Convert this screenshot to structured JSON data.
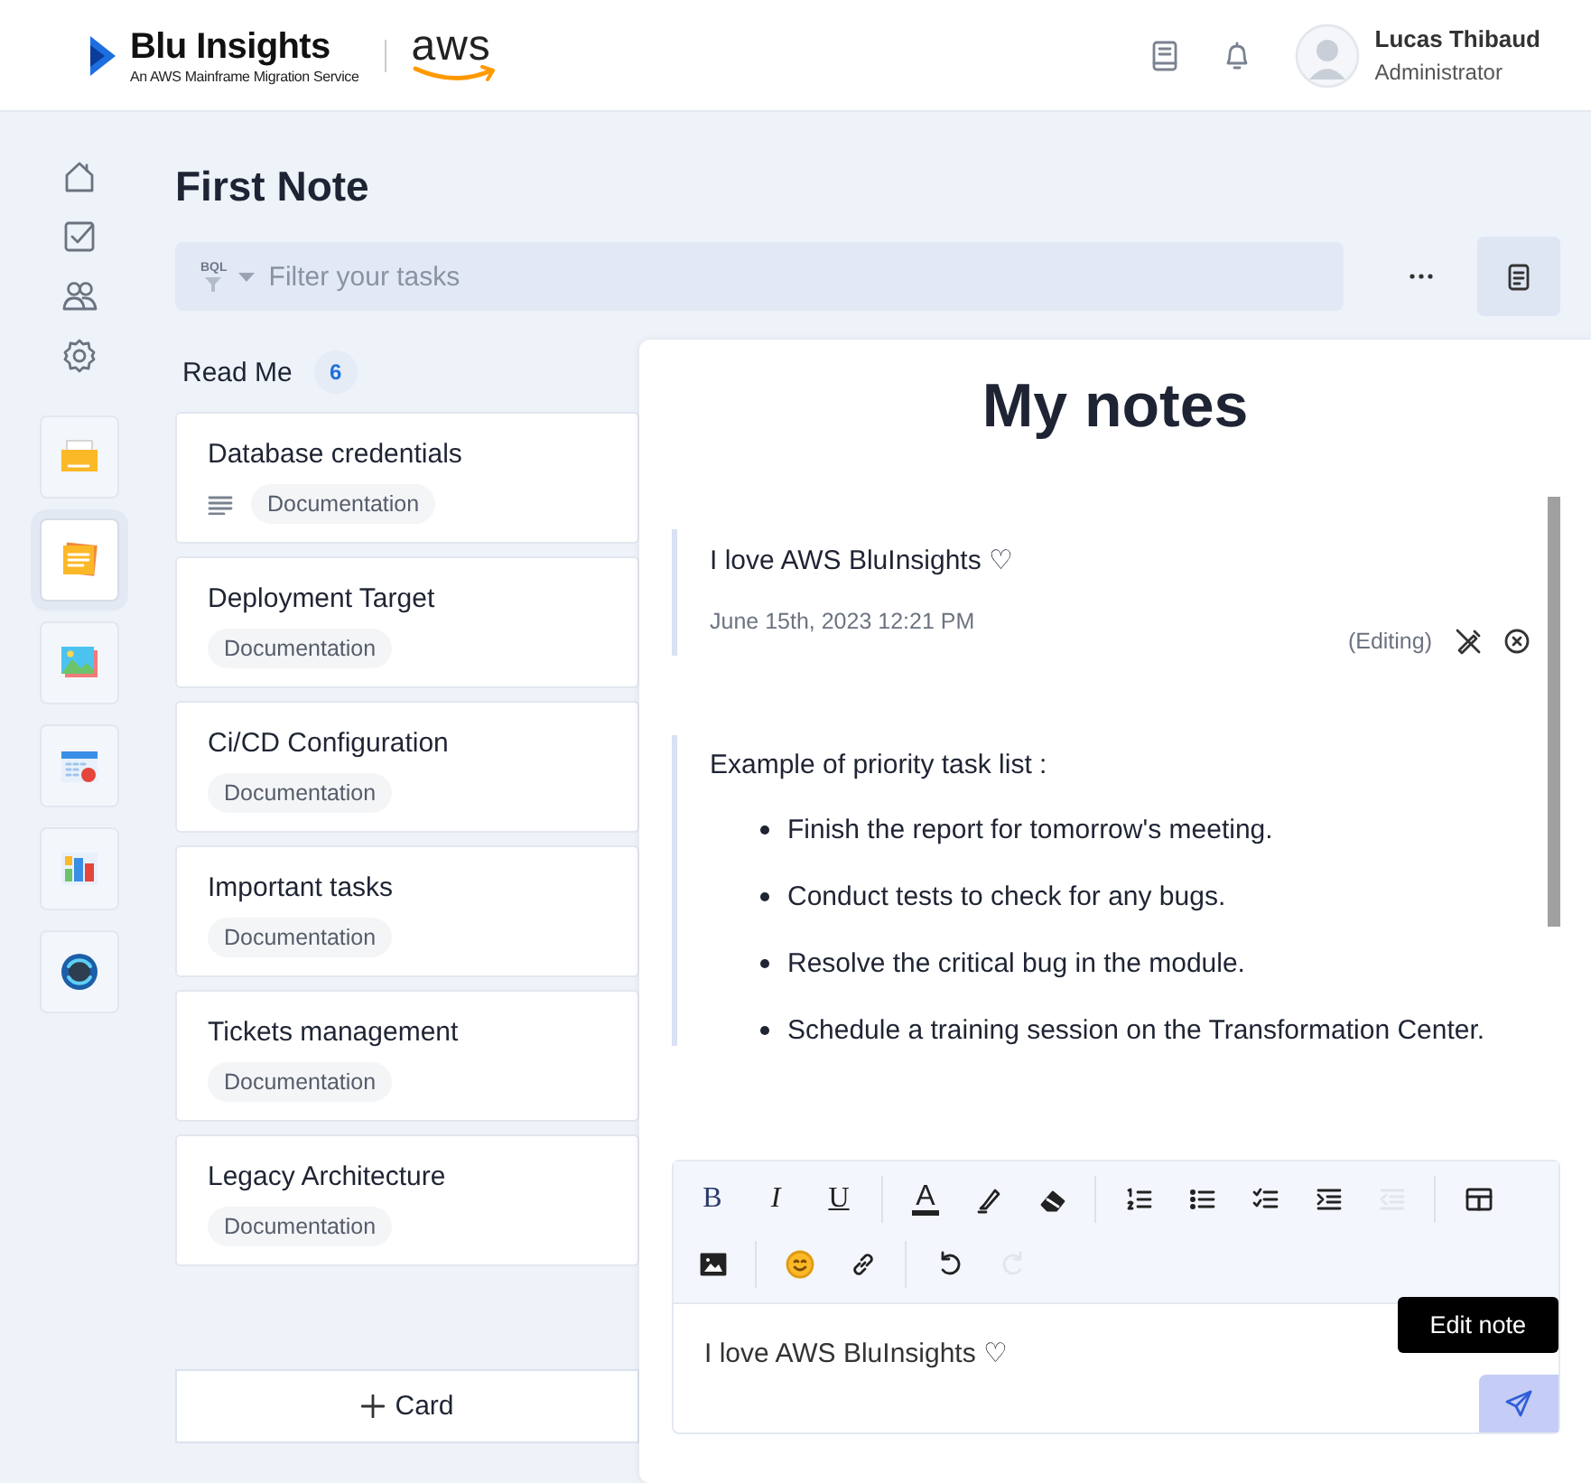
{
  "header": {
    "logo_title": "Blu Insights",
    "logo_subtitle": "An AWS Mainframe Migration Service",
    "partner_logo": "aws",
    "user": {
      "name": "Lucas Thibaud",
      "role": "Administrator"
    }
  },
  "nav": {
    "links": [
      {
        "kind": "home"
      },
      {
        "kind": "tasks"
      },
      {
        "kind": "users"
      },
      {
        "kind": "settings"
      }
    ],
    "apps": [
      {
        "kind": "folder",
        "selected": false
      },
      {
        "kind": "notes",
        "selected": true
      },
      {
        "kind": "gallery",
        "selected": false
      },
      {
        "kind": "calendar",
        "selected": false
      },
      {
        "kind": "dashboard",
        "selected": false
      },
      {
        "kind": "sync",
        "selected": false
      }
    ]
  },
  "page": {
    "title": "First Note"
  },
  "filter": {
    "prefix": "BQL",
    "placeholder": "Filter your tasks"
  },
  "column": {
    "title": "Read Me",
    "count": "6",
    "add_label": "Card",
    "cards": [
      {
        "title": "Database credentials",
        "tag": "Documentation",
        "has_description": true
      },
      {
        "title": "Deployment Target",
        "tag": "Documentation",
        "has_description": false
      },
      {
        "title": "Ci/CD Configuration",
        "tag": "Documentation",
        "has_description": false
      },
      {
        "title": "Important tasks",
        "tag": "Documentation",
        "has_description": false
      },
      {
        "title": "Tickets management",
        "tag": "Documentation",
        "has_description": false
      },
      {
        "title": "Legacy Architecture",
        "tag": "Documentation",
        "has_description": false
      }
    ]
  },
  "notes_panel": {
    "title": "My notes",
    "notes": [
      {
        "kind": "text",
        "text": "I love AWS BluInsights ♡",
        "date": "June 15th, 2023 12:21 PM",
        "status": "(Editing)"
      },
      {
        "kind": "list",
        "intro": "Example of priority task list :",
        "items": [
          "Finish the report for tomorrow's meeting.",
          "Conduct tests to check for any bugs.",
          "Resolve the critical bug in the module.",
          "Schedule a training session on the Transformation Center."
        ]
      }
    ],
    "editor": {
      "value": "I love AWS BluInsights ♡",
      "tooltip": "Edit note",
      "toolbar_rows": [
        [
          [
            {
              "kind": "bold",
              "label": "B",
              "disabled": false
            },
            {
              "kind": "italic",
              "label": "I",
              "disabled": false
            },
            {
              "kind": "underline",
              "label": "U",
              "disabled": false
            }
          ],
          [
            {
              "kind": "text-color",
              "label": "A",
              "disabled": false
            },
            {
              "kind": "highlight",
              "disabled": false
            },
            {
              "kind": "eraser",
              "disabled": false
            }
          ],
          [
            {
              "kind": "ordered-list",
              "disabled": false
            },
            {
              "kind": "bullet-list",
              "disabled": false
            },
            {
              "kind": "check-list",
              "disabled": false
            },
            {
              "kind": "indent",
              "disabled": false
            },
            {
              "kind": "outdent",
              "disabled": true
            }
          ],
          [
            {
              "kind": "table",
              "disabled": false
            }
          ]
        ],
        [
          [
            {
              "kind": "image",
              "disabled": false
            }
          ],
          [
            {
              "kind": "emoji",
              "disabled": false
            },
            {
              "kind": "link",
              "disabled": false
            }
          ],
          [
            {
              "kind": "undo",
              "disabled": false
            },
            {
              "kind": "redo",
              "disabled": true
            }
          ]
        ]
      ]
    }
  }
}
